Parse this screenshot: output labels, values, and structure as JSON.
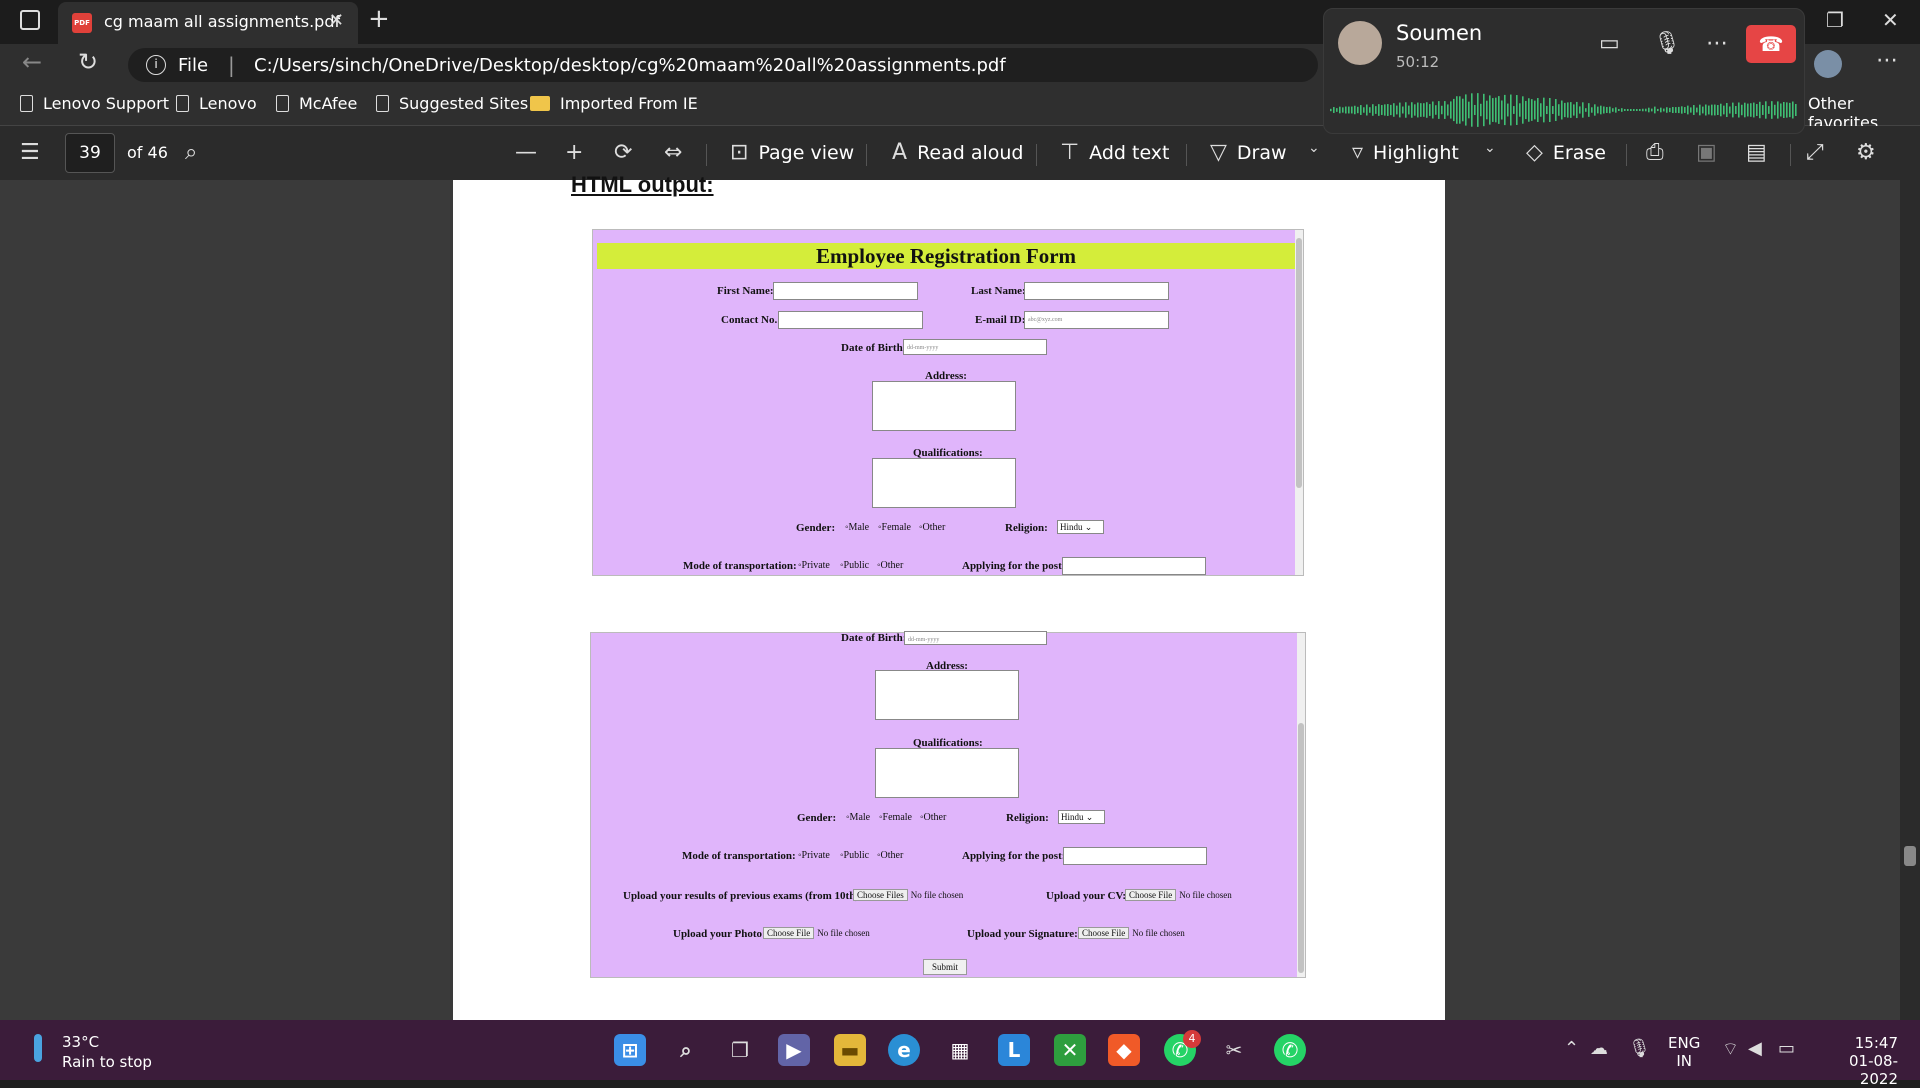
{
  "browser": {
    "tab_title": "cg maam all assignments.pdf",
    "tab_close": "✕",
    "new_tab": "+",
    "address_scheme": "File",
    "address_url": "C:/Users/sinch/OneDrive/Desktop/desktop/cg%20maam%20all%20assignments.pdf",
    "favorites": [
      "Lenovo Support",
      "Lenovo",
      "McAfee",
      "Suggested Sites",
      "Imported From IE"
    ],
    "other_favorites": "Other favorites"
  },
  "pdf_toolbar": {
    "page_number": "39",
    "page_total": "of 46",
    "page_view": "Page view",
    "read_aloud": "Read aloud",
    "add_text": "Add text",
    "draw": "Draw",
    "highlight": "Highlight",
    "erase": "Erase"
  },
  "document": {
    "section_heading": "HTML output:",
    "form_title": "Employee Registration Form",
    "first_name": "First Name:",
    "last_name": "Last Name:",
    "contact": "Contact No.:",
    "email": "E-mail ID:",
    "email_placeholder": "abc@xyz.com",
    "dob": "Date of Birth:",
    "dob_placeholder": "dd-mm-yyyy",
    "address": "Address:",
    "qualifications": "Qualifications:",
    "gender": "Gender:",
    "gender_options": [
      "Male",
      "Female",
      "Other"
    ],
    "religion": "Religion:",
    "religion_value": "Hindu",
    "transport": "Mode of transportation:",
    "transport_options": [
      "Private",
      "Public",
      "Other"
    ],
    "post": "Applying for the post:",
    "upload_results": "Upload your results of previous exams (from 10th):",
    "upload_cv": "Upload your CV:",
    "upload_photo": "Upload your Photo:",
    "upload_signature": "Upload your Signature:",
    "choose_files": "Choose Files",
    "choose_file": "Choose File",
    "no_file": "No file chosen",
    "submit": "Submit"
  },
  "call": {
    "name": "Soumen",
    "duration": "50:12"
  },
  "taskbar": {
    "temperature": "33°C",
    "weather_text": "Rain to stop",
    "whatsapp_badge": "4",
    "language": "ENG",
    "region": "IN",
    "time": "15:47",
    "date": "01-08-2022"
  }
}
